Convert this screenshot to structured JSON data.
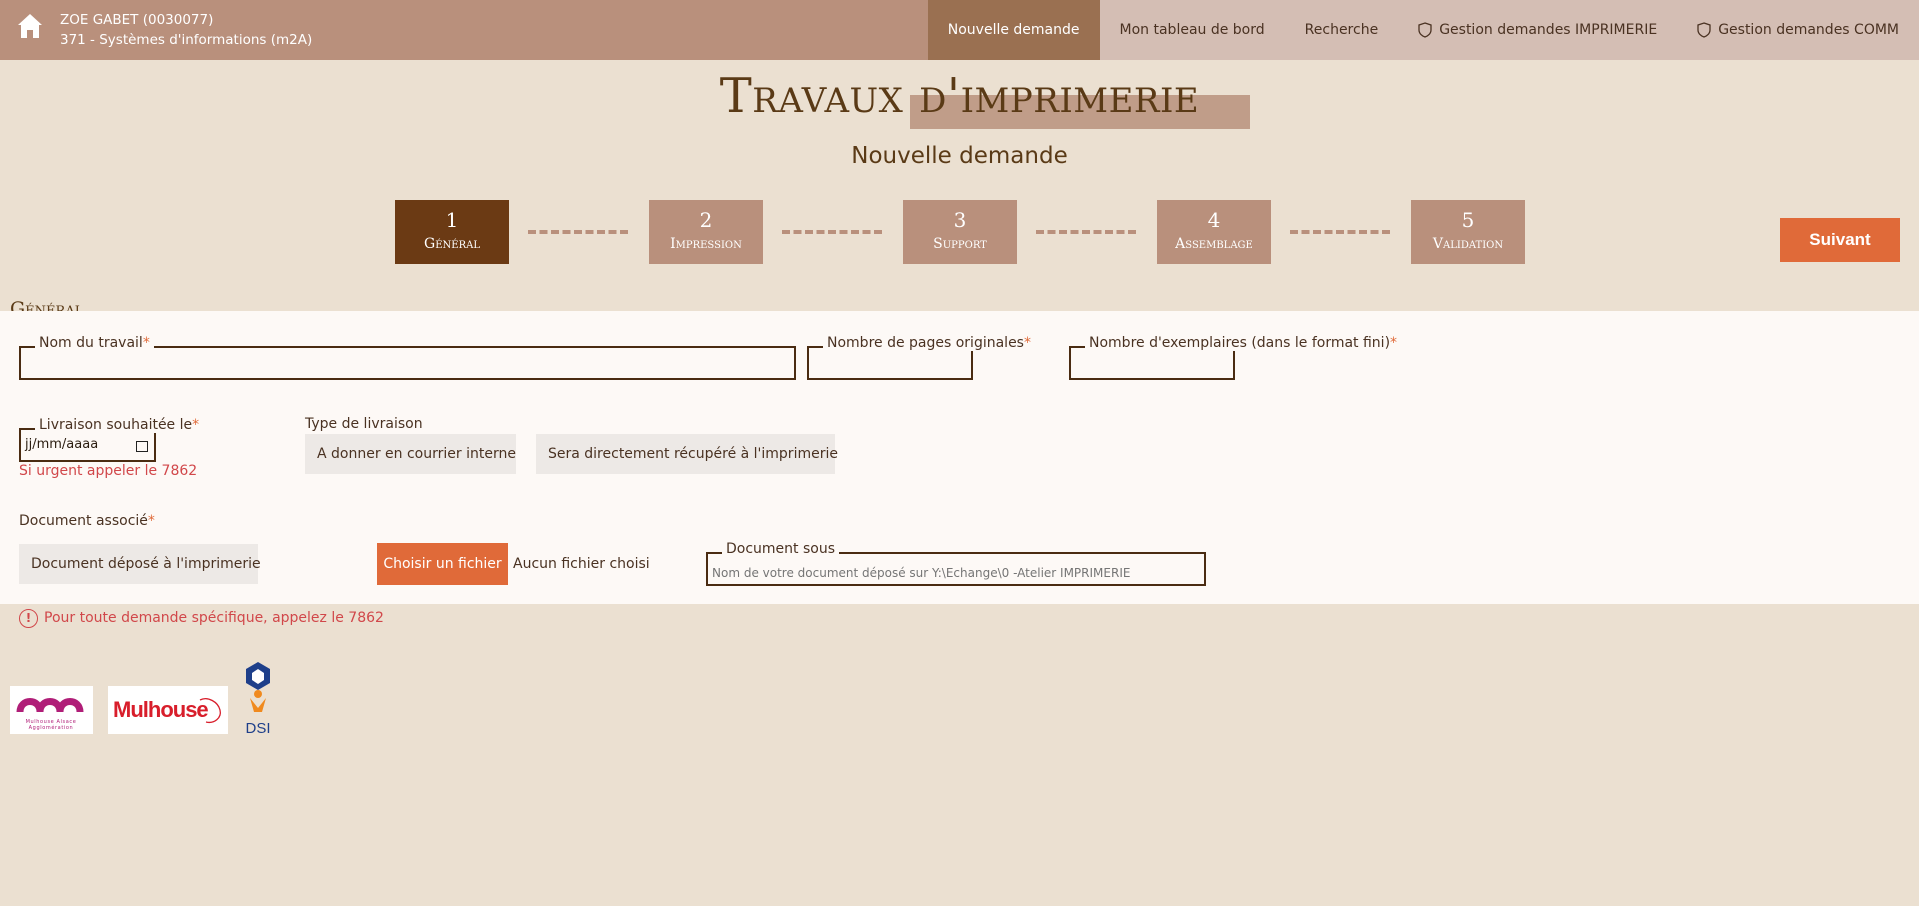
{
  "header": {
    "user_name": "ZOE GABET (0030077)",
    "user_dept": "371 - Systèmes d'informations (m2A)",
    "nav": [
      {
        "label": "Nouvelle demande",
        "icon": ""
      },
      {
        "label": "Mon tableau de bord",
        "icon": ""
      },
      {
        "label": "Recherche",
        "icon": ""
      },
      {
        "label": "Gestion demandes IMPRIMERIE",
        "icon": "shield-icon"
      },
      {
        "label": "Gestion demandes COMM",
        "icon": "shield-icon"
      }
    ]
  },
  "page": {
    "title": "Travaux d'imprimerie",
    "subtitle": "Nouvelle demande",
    "next_label": "Suivant"
  },
  "steps": [
    {
      "num": "1",
      "label": "Général",
      "active": true
    },
    {
      "num": "2",
      "label": "Impression",
      "active": false
    },
    {
      "num": "3",
      "label": "Support",
      "active": false
    },
    {
      "num": "4",
      "label": "Assemblage",
      "active": false
    },
    {
      "num": "5",
      "label": "Validation",
      "active": false
    }
  ],
  "form": {
    "section_title": "Général",
    "job_name_label": "Nom du travail",
    "pages_label": "Nombre de pages originales",
    "copies_label": "Nombre d'exemplaires (dans le format fini)",
    "delivery_label": "Livraison souhaitée le",
    "delivery_value": "jj/mm/aaaa",
    "urgent_note": "Si urgent appeler le 7862",
    "delivery_type_label": "Type de livraison",
    "delivery_opt1": "A donner en courrier interne",
    "delivery_opt2": "Sera directement récupéré à l'imprimerie",
    "doc_label": "Document associé",
    "doc_opt": "Document déposé à l'imprimerie",
    "file_button": "Choisir un fichier",
    "file_status": "Aucun fichier choisi",
    "doc_under_label": "Document sous",
    "doc_under_placeholder": "Nom de votre document déposé sur Y:\\Echange\\0 -Atelier IMPRIMERIE",
    "required_mark": "*"
  },
  "footer_note": "Pour toute demande spécifique, appelez le 7862",
  "logos": {
    "m2a_line1": "Mulhouse Alsace",
    "m2a_line2": "Agglomération",
    "mulhouse": "Mulhouse",
    "dsi": "DSI"
  },
  "colors": {
    "accent": "#e06a39",
    "header": "#b9907c",
    "active_step": "#6b3a14",
    "background": "#ebe0d1"
  }
}
